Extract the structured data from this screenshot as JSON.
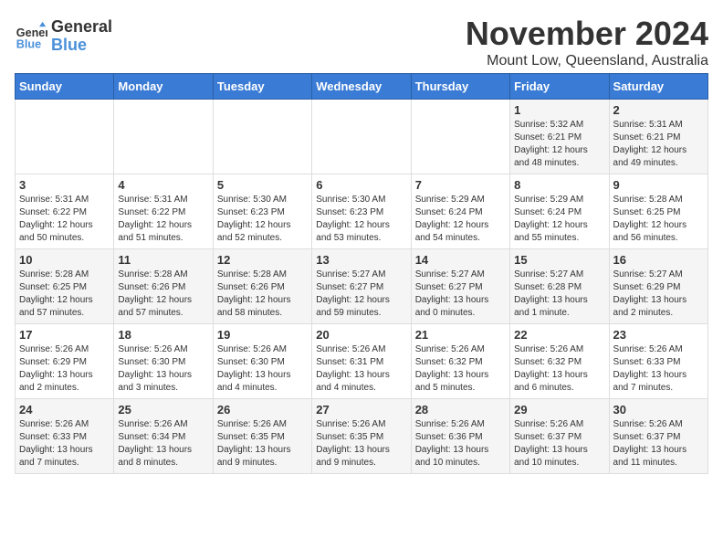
{
  "header": {
    "logo_general": "General",
    "logo_blue": "Blue",
    "month_title": "November 2024",
    "location": "Mount Low, Queensland, Australia"
  },
  "days_of_week": [
    "Sunday",
    "Monday",
    "Tuesday",
    "Wednesday",
    "Thursday",
    "Friday",
    "Saturday"
  ],
  "weeks": [
    {
      "cells": [
        {
          "day": null,
          "content": ""
        },
        {
          "day": null,
          "content": ""
        },
        {
          "day": null,
          "content": ""
        },
        {
          "day": null,
          "content": ""
        },
        {
          "day": null,
          "content": ""
        },
        {
          "day": "1",
          "content": "Sunrise: 5:32 AM\nSunset: 6:21 PM\nDaylight: 12 hours\nand 48 minutes."
        },
        {
          "day": "2",
          "content": "Sunrise: 5:31 AM\nSunset: 6:21 PM\nDaylight: 12 hours\nand 49 minutes."
        }
      ]
    },
    {
      "cells": [
        {
          "day": "3",
          "content": "Sunrise: 5:31 AM\nSunset: 6:22 PM\nDaylight: 12 hours\nand 50 minutes."
        },
        {
          "day": "4",
          "content": "Sunrise: 5:31 AM\nSunset: 6:22 PM\nDaylight: 12 hours\nand 51 minutes."
        },
        {
          "day": "5",
          "content": "Sunrise: 5:30 AM\nSunset: 6:23 PM\nDaylight: 12 hours\nand 52 minutes."
        },
        {
          "day": "6",
          "content": "Sunrise: 5:30 AM\nSunset: 6:23 PM\nDaylight: 12 hours\nand 53 minutes."
        },
        {
          "day": "7",
          "content": "Sunrise: 5:29 AM\nSunset: 6:24 PM\nDaylight: 12 hours\nand 54 minutes."
        },
        {
          "day": "8",
          "content": "Sunrise: 5:29 AM\nSunset: 6:24 PM\nDaylight: 12 hours\nand 55 minutes."
        },
        {
          "day": "9",
          "content": "Sunrise: 5:28 AM\nSunset: 6:25 PM\nDaylight: 12 hours\nand 56 minutes."
        }
      ]
    },
    {
      "cells": [
        {
          "day": "10",
          "content": "Sunrise: 5:28 AM\nSunset: 6:25 PM\nDaylight: 12 hours\nand 57 minutes."
        },
        {
          "day": "11",
          "content": "Sunrise: 5:28 AM\nSunset: 6:26 PM\nDaylight: 12 hours\nand 57 minutes."
        },
        {
          "day": "12",
          "content": "Sunrise: 5:28 AM\nSunset: 6:26 PM\nDaylight: 12 hours\nand 58 minutes."
        },
        {
          "day": "13",
          "content": "Sunrise: 5:27 AM\nSunset: 6:27 PM\nDaylight: 12 hours\nand 59 minutes."
        },
        {
          "day": "14",
          "content": "Sunrise: 5:27 AM\nSunset: 6:27 PM\nDaylight: 13 hours\nand 0 minutes."
        },
        {
          "day": "15",
          "content": "Sunrise: 5:27 AM\nSunset: 6:28 PM\nDaylight: 13 hours\nand 1 minute."
        },
        {
          "day": "16",
          "content": "Sunrise: 5:27 AM\nSunset: 6:29 PM\nDaylight: 13 hours\nand 2 minutes."
        }
      ]
    },
    {
      "cells": [
        {
          "day": "17",
          "content": "Sunrise: 5:26 AM\nSunset: 6:29 PM\nDaylight: 13 hours\nand 2 minutes."
        },
        {
          "day": "18",
          "content": "Sunrise: 5:26 AM\nSunset: 6:30 PM\nDaylight: 13 hours\nand 3 minutes."
        },
        {
          "day": "19",
          "content": "Sunrise: 5:26 AM\nSunset: 6:30 PM\nDaylight: 13 hours\nand 4 minutes."
        },
        {
          "day": "20",
          "content": "Sunrise: 5:26 AM\nSunset: 6:31 PM\nDaylight: 13 hours\nand 4 minutes."
        },
        {
          "day": "21",
          "content": "Sunrise: 5:26 AM\nSunset: 6:32 PM\nDaylight: 13 hours\nand 5 minutes."
        },
        {
          "day": "22",
          "content": "Sunrise: 5:26 AM\nSunset: 6:32 PM\nDaylight: 13 hours\nand 6 minutes."
        },
        {
          "day": "23",
          "content": "Sunrise: 5:26 AM\nSunset: 6:33 PM\nDaylight: 13 hours\nand 7 minutes."
        }
      ]
    },
    {
      "cells": [
        {
          "day": "24",
          "content": "Sunrise: 5:26 AM\nSunset: 6:33 PM\nDaylight: 13 hours\nand 7 minutes."
        },
        {
          "day": "25",
          "content": "Sunrise: 5:26 AM\nSunset: 6:34 PM\nDaylight: 13 hours\nand 8 minutes."
        },
        {
          "day": "26",
          "content": "Sunrise: 5:26 AM\nSunset: 6:35 PM\nDaylight: 13 hours\nand 9 minutes."
        },
        {
          "day": "27",
          "content": "Sunrise: 5:26 AM\nSunset: 6:35 PM\nDaylight: 13 hours\nand 9 minutes."
        },
        {
          "day": "28",
          "content": "Sunrise: 5:26 AM\nSunset: 6:36 PM\nDaylight: 13 hours\nand 10 minutes."
        },
        {
          "day": "29",
          "content": "Sunrise: 5:26 AM\nSunset: 6:37 PM\nDaylight: 13 hours\nand 10 minutes."
        },
        {
          "day": "30",
          "content": "Sunrise: 5:26 AM\nSunset: 6:37 PM\nDaylight: 13 hours\nand 11 minutes."
        }
      ]
    }
  ]
}
